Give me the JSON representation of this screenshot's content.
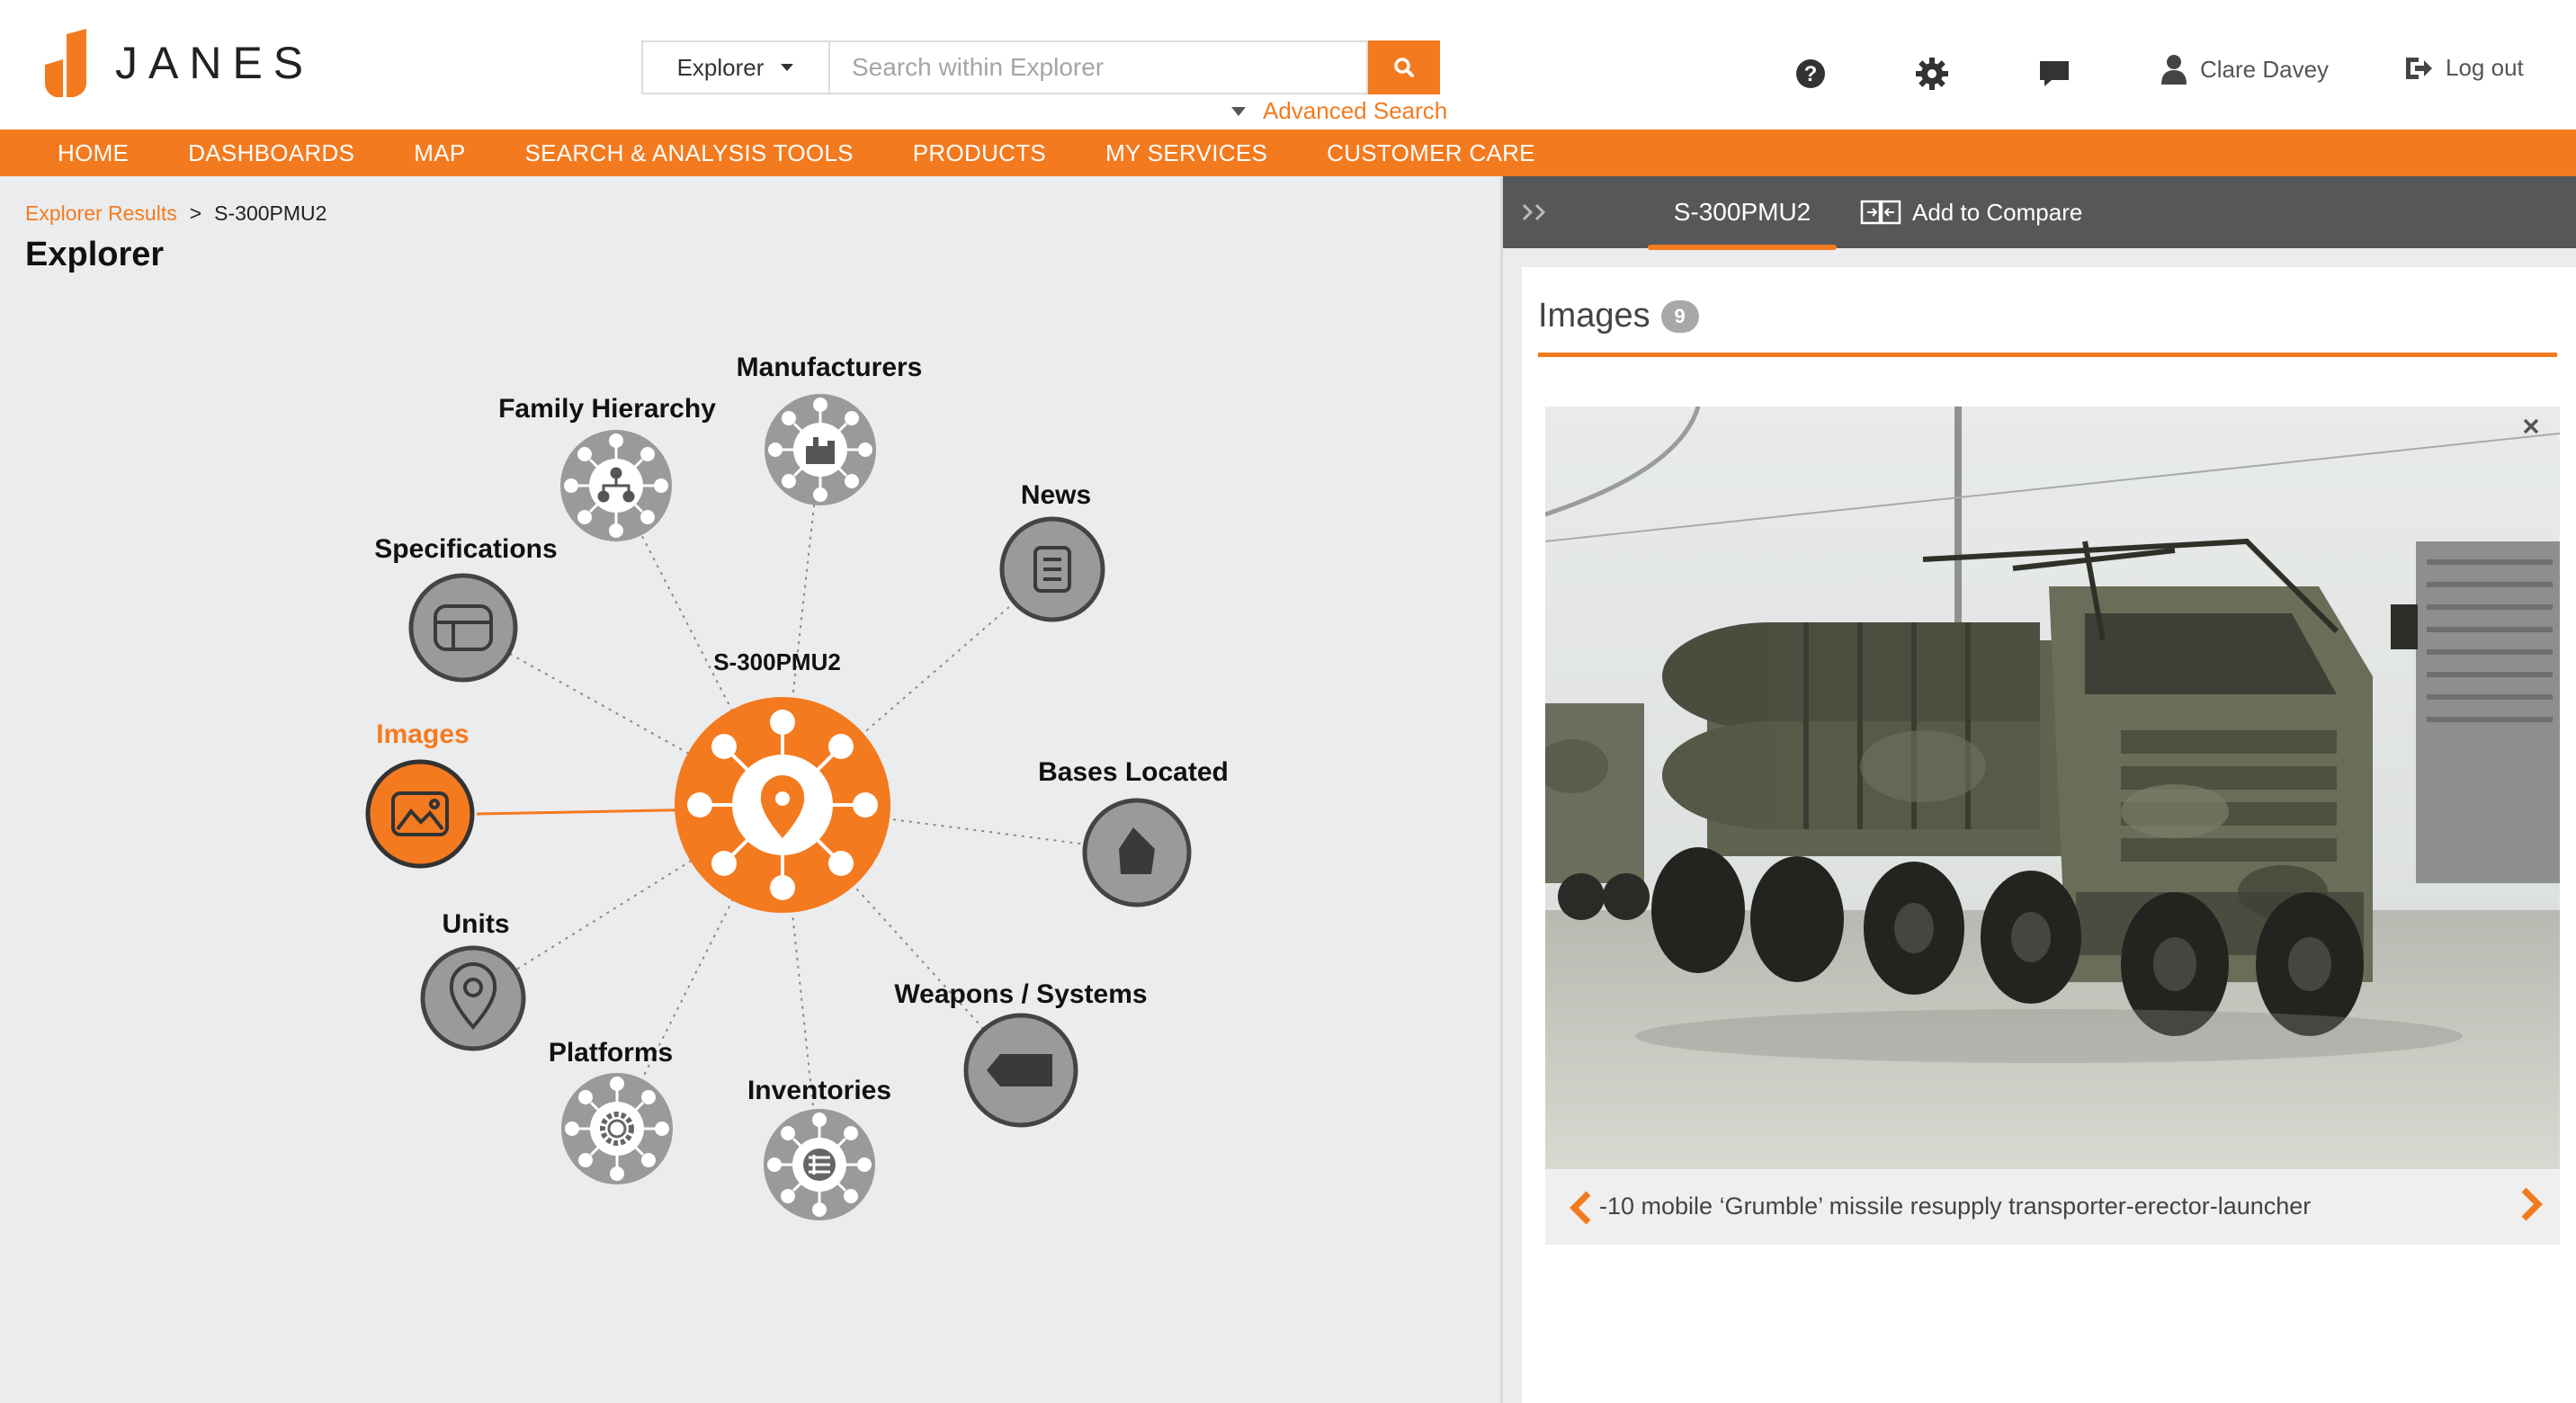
{
  "brand": {
    "name": "JANES"
  },
  "search": {
    "scope": "Explorer",
    "placeholder": "Search within Explorer",
    "advanced_label": "Advanced Search"
  },
  "header_icons": [
    "help-icon",
    "settings-icon",
    "chat-icon"
  ],
  "user": {
    "name": "Clare Davey",
    "logout_label": "Log out"
  },
  "nav": [
    "HOME",
    "DASHBOARDS",
    "MAP",
    "SEARCH & ANALYSIS TOOLS",
    "PRODUCTS",
    "MY SERVICES",
    "CUSTOMER CARE"
  ],
  "breadcrumb": {
    "parent": "Explorer Results",
    "separator": ">",
    "current": "S-300PMU2"
  },
  "page_title": "Explorer",
  "graph": {
    "center_label": "S-300PMU2",
    "nodes": [
      {
        "label": "Family Hierarchy",
        "kind": "hub",
        "icon": "hierarchy-icon",
        "active": false
      },
      {
        "label": "Manufacturers",
        "kind": "hub",
        "icon": "factory-icon",
        "active": false
      },
      {
        "label": "News",
        "kind": "leaf",
        "icon": "news-icon",
        "active": false
      },
      {
        "label": "Specifications",
        "kind": "leaf",
        "icon": "specifications-icon",
        "active": false
      },
      {
        "label": "Images",
        "kind": "leaf",
        "icon": "image-icon",
        "active": true
      },
      {
        "label": "Bases Located",
        "kind": "leaf",
        "icon": "base-icon",
        "active": false
      },
      {
        "label": "Units",
        "kind": "leaf",
        "icon": "location-pin-icon",
        "active": false
      },
      {
        "label": "Weapons / Systems",
        "kind": "leaf",
        "icon": "weapon-icon",
        "active": false
      },
      {
        "label": "Platforms",
        "kind": "hub",
        "icon": "gear-icon",
        "active": false
      },
      {
        "label": "Inventories",
        "kind": "hub",
        "icon": "list-icon",
        "active": false
      }
    ]
  },
  "right_panel": {
    "tab_label": "S-300PMU2",
    "compare_label": "Add to Compare",
    "images_title": "Images",
    "images_count": "9",
    "caption": "-10 mobile ‘Grumble’ missile resupply transporter-erector-launcher"
  },
  "colors": {
    "accent": "#f47a1f",
    "node_grey": "#9a9a9a",
    "bar_dark": "#555759"
  }
}
